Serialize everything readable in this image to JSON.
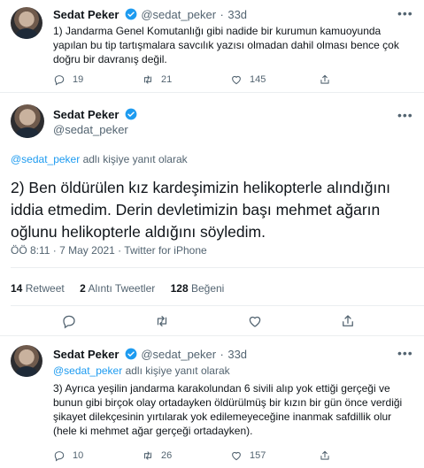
{
  "tweet1": {
    "name": "Sedat Peker",
    "handle": "@sedat_peker",
    "separator": "·",
    "time": "33d",
    "text": "1) Jandarma Genel Komutanlığı gibi nadide bir kurumun kamuoyunda yapılan bu tip tartışmalara savcılık yazısı olmadan dahil olması bence çok doğru bir davranış değil.",
    "replies": "19",
    "retweets": "21",
    "likes": "145"
  },
  "main": {
    "name": "Sedat Peker",
    "handle": "@sedat_peker",
    "reply_handle": "@sedat_peker",
    "reply_suffix": " adlı kişiye yanıt olarak",
    "text": "2) Ben öldürülen kız kardeşimizin helikopterle alındığını iddia etmedim. Derin devletimizin başı mehmet ağarın oğlunu helikopterle aldığını söyledim.",
    "meta": "ÖÖ 8:11 · 7 May 2021 · Twitter for iPhone",
    "retweet_count": "14",
    "retweet_label": "Retweet",
    "quote_count": "2",
    "quote_label": "Alıntı Tweetler",
    "like_count": "128",
    "like_label": "Beğeni"
  },
  "tweet3": {
    "name": "Sedat Peker",
    "handle": "@sedat_peker",
    "separator": "·",
    "time": "33d",
    "reply_handle": "@sedat_peker",
    "reply_suffix": " adlı kişiye yanıt olarak",
    "text": "3) Ayrıca yeşilin jandarma karakolundan 6 sivili alıp yok ettiği gerçeği ve bunun gibi birçok olay ortadayken öldürülmüş bir kızın bir gün önce verdiği şikayet dilekçesinin yırtılarak yok edilemeyeceğine inanmak safdillik olur (hele ki mehmet ağar gerçeği ortadayken).",
    "replies": "10",
    "retweets": "26",
    "likes": "157"
  },
  "colors": {
    "accent": "#1d9bf0",
    "text": "#0f1419",
    "muted": "#536471",
    "divider": "#ebeef0"
  },
  "icons": [
    "verified-badge-icon",
    "more-icon",
    "reply-icon",
    "retweet-icon",
    "like-icon",
    "share-icon"
  ]
}
